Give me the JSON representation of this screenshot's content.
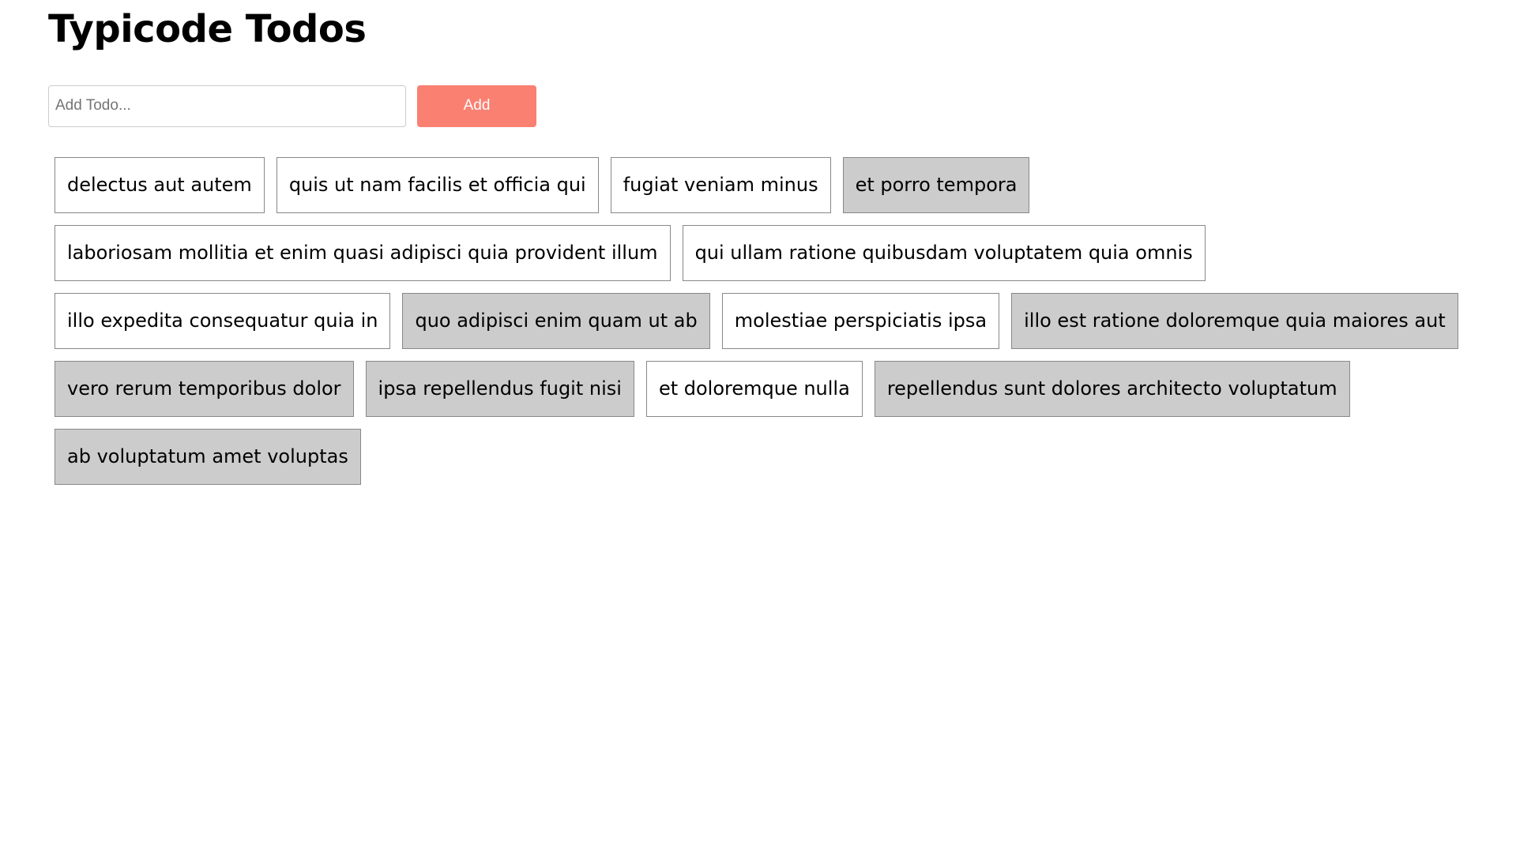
{
  "header": {
    "title": "Typicode Todos"
  },
  "form": {
    "placeholder": "Add Todo...",
    "add_label": "Add"
  },
  "todos": [
    {
      "title": "delectus aut autem",
      "completed": false
    },
    {
      "title": "quis ut nam facilis et officia qui",
      "completed": false
    },
    {
      "title": "fugiat veniam minus",
      "completed": false
    },
    {
      "title": "et porro tempora",
      "completed": true
    },
    {
      "title": "laboriosam mollitia et enim quasi adipisci quia provident illum",
      "completed": false
    },
    {
      "title": "qui ullam ratione quibusdam voluptatem quia omnis",
      "completed": false
    },
    {
      "title": "illo expedita consequatur quia in",
      "completed": false
    },
    {
      "title": "quo adipisci enim quam ut ab",
      "completed": true
    },
    {
      "title": "molestiae perspiciatis ipsa",
      "completed": false
    },
    {
      "title": "illo est ratione doloremque quia maiores aut",
      "completed": true
    },
    {
      "title": "vero rerum temporibus dolor",
      "completed": true
    },
    {
      "title": "ipsa repellendus fugit nisi",
      "completed": true
    },
    {
      "title": "et doloremque nulla",
      "completed": false
    },
    {
      "title": "repellendus sunt dolores architecto voluptatum",
      "completed": true
    },
    {
      "title": "ab voluptatum amet voluptas",
      "completed": true
    }
  ],
  "colors": {
    "add_button": "#fa8072",
    "completed_bg": "#cccccc",
    "item_border": "#888888"
  }
}
